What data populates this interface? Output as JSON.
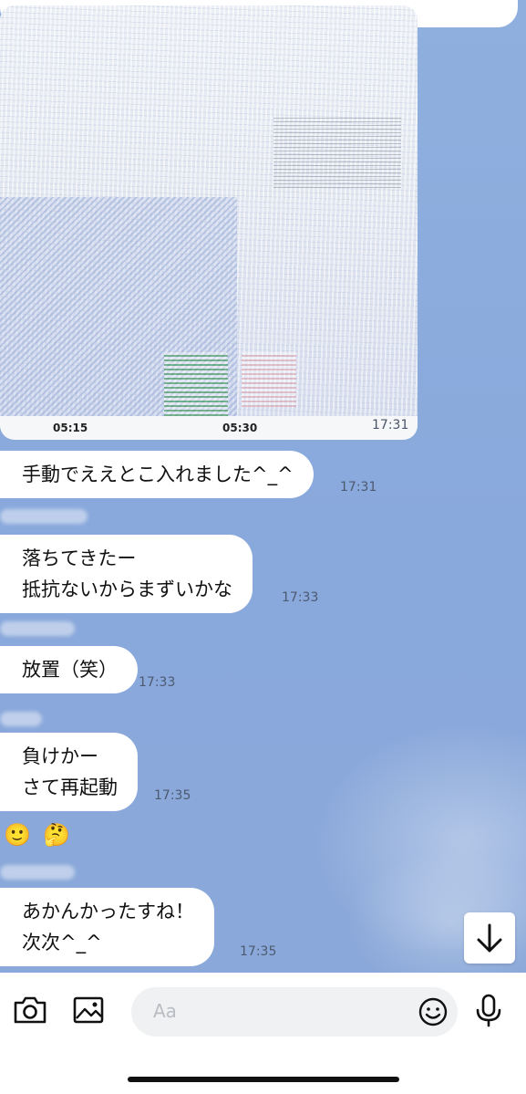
{
  "image_message": {
    "axis_labels": [
      "05:15",
      "05:30"
    ],
    "time": "17:31"
  },
  "messages": [
    {
      "text": "手動でええとこ入れました^_^",
      "time": "17:31"
    },
    {
      "text": "落ちてきたー\n抵抗ないからまずいかな",
      "time": "17:33"
    },
    {
      "text": "放置（笑）",
      "time": "17:33"
    },
    {
      "text": "負けかー\nさて再起動",
      "time": "17:35"
    },
    {
      "text": "あかんかったすね！\n次次^_^",
      "time": "17:35"
    }
  ],
  "reactions": [
    "🙂",
    "🤔"
  ],
  "input_bar": {
    "placeholder": "Aa",
    "icons": [
      "camera-icon",
      "image-icon",
      "emoji-icon",
      "microphone-icon"
    ]
  },
  "scroll_button_icon": "arrow-down-icon",
  "colors": {
    "chat_background": "#8aa8dc",
    "bubble": "#ffffff",
    "input_field": "#f0f1f3"
  }
}
